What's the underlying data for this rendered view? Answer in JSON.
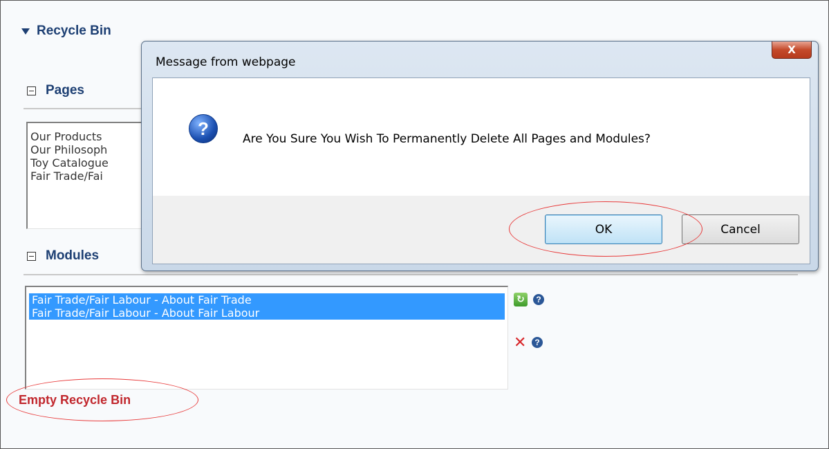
{
  "page": {
    "section_title": "Recycle Bin",
    "pages": {
      "header": "Pages",
      "items": [
        "Our Products",
        "Our Philosoph",
        "Toy Catalogue",
        "Fair Trade/Fai"
      ]
    },
    "modules": {
      "header": "Modules",
      "items": [
        {
          "label": "Fair Trade/Fair Labour - About Fair Trade",
          "selected": true
        },
        {
          "label": "Fair Trade/Fair Labour - About Fair Labour",
          "selected": true
        }
      ]
    },
    "icons": {
      "restore": "restore-icon",
      "help": "help-icon",
      "delete": "delete-icon"
    },
    "empty_link": "Empty Recycle Bin"
  },
  "dialog": {
    "title": "Message from webpage",
    "close_label": "X",
    "message": "Are You Sure You Wish To Permanently Delete All Pages and Modules?",
    "icon": "question-icon",
    "ok_label": "OK",
    "cancel_label": "Cancel"
  },
  "colors": {
    "heading": "#1d3f73",
    "selection": "#3399ff",
    "link_red": "#c1272d",
    "annotation_red": "#e83a3a"
  }
}
